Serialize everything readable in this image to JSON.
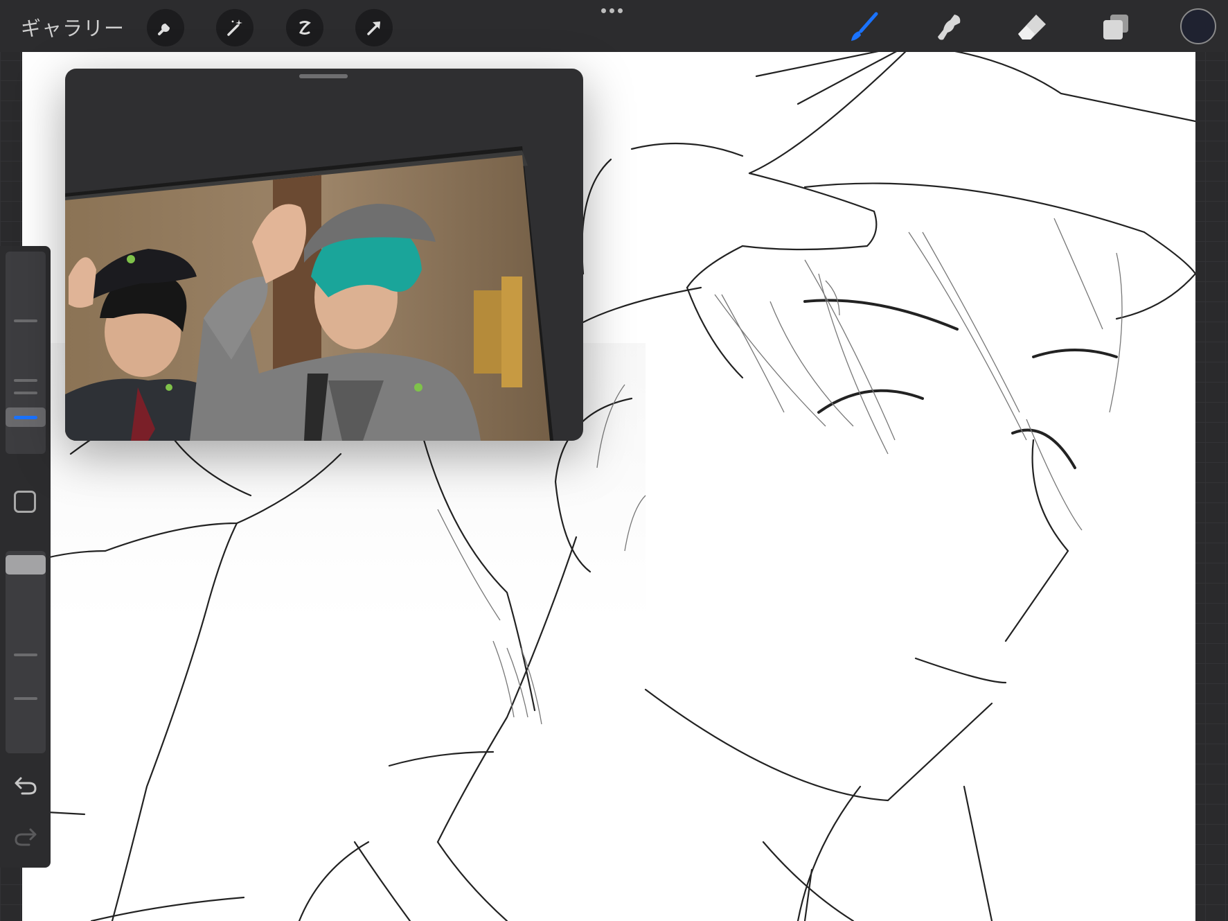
{
  "topbar": {
    "gallery_label": "ギャラリー",
    "left_tools": [
      "wrench-icon",
      "magic-wand-icon",
      "selection-icon",
      "transform-arrow-icon"
    ],
    "right_tools": [
      "brush-icon",
      "smudge-icon",
      "eraser-icon",
      "layers-icon"
    ],
    "active_tool": "brush-icon",
    "current_color": "#1f2230",
    "accent_color": "#1a73ff"
  },
  "sidebar": {
    "brush_size_fraction": 0.1,
    "opacity_fraction": 0.92
  },
  "reference_panel": {
    "visible": true
  }
}
